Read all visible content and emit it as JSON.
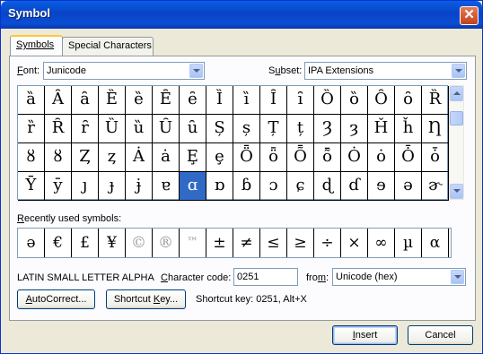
{
  "window": {
    "title": "Symbol",
    "close_glyph": "✕"
  },
  "tabs": [
    {
      "label": "Symbols"
    },
    {
      "label": "Special Characters"
    }
  ],
  "font": {
    "label_u": "F",
    "label_rest": "ont:",
    "value": "Junicode"
  },
  "subset": {
    "label_pre": "S",
    "label_u": "u",
    "label_rest": "bset:",
    "value": "IPA Extensions"
  },
  "grid": {
    "rows": [
      [
        "ȁ",
        "Ȃ",
        "ȃ",
        "Ȅ",
        "ȅ",
        "Ȇ",
        "ȇ",
        "Ȉ",
        "ȉ",
        "Ȋ",
        "ȋ",
        "Ȍ",
        "ȍ",
        "Ȏ",
        "ȏ",
        "Ȑ"
      ],
      [
        "ȑ",
        "Ȓ",
        "ȓ",
        "Ȕ",
        "ȕ",
        "Ȗ",
        "ȗ",
        "Ș",
        "ș",
        "Ț",
        "ț",
        "Ȝ",
        "ȝ",
        "Ȟ",
        "ȟ",
        "Ƞ"
      ],
      [
        "ȣ",
        "ȣ",
        "Ȥ",
        "ȥ",
        "Ȧ",
        "ȧ",
        "Ȩ",
        "ȩ",
        "Ȫ",
        "ȫ",
        "Ȭ",
        "ȭ",
        "Ȯ",
        "ȯ",
        "Ȱ",
        "ȱ"
      ],
      [
        "Ȳ",
        "ȳ",
        "ȷ",
        "ɟ",
        "ɉ",
        "ɐ",
        "ɑ",
        "ɒ",
        "ɓ",
        "ɔ",
        "ɕ",
        "ɖ",
        "ɗ",
        "ɘ",
        "ə",
        "ɚ"
      ]
    ],
    "selected_row": 3,
    "selected_col": 6
  },
  "recent": {
    "label_u": "R",
    "label_rest": "ecently used symbols:",
    "symbols": [
      "ə",
      "€",
      "£",
      "¥",
      "©",
      "®",
      "™",
      "±",
      "≠",
      "≤",
      "≥",
      "÷",
      "×",
      "∞",
      "µ",
      "α"
    ]
  },
  "char_name": "LATIN SMALL LETTER ALPHA",
  "char_code": {
    "label_pre": "",
    "label_u": "C",
    "label_rest": "haracter code:",
    "value": "0251"
  },
  "from": {
    "label_pre": "fro",
    "label_u": "m",
    "label_rest": ":",
    "value": "Unicode (hex)"
  },
  "buttons": {
    "autocorrect": {
      "pre": "",
      "u": "A",
      "rest": "utoCorrect..."
    },
    "shortcut_key": {
      "pre": "Shortcut ",
      "u": "K",
      "rest": "ey..."
    },
    "insert": {
      "pre": "",
      "u": "I",
      "rest": "nsert"
    },
    "cancel": "Cancel"
  },
  "shortcut_text": "Shortcut key: 0251, Alt+X"
}
